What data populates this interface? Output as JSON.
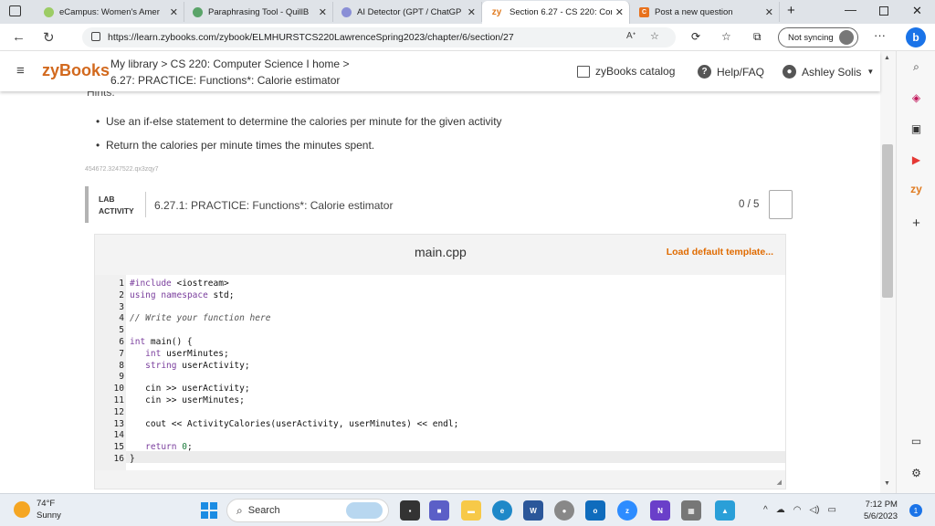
{
  "browser": {
    "tabs": [
      {
        "label": "eCampus: Women's Amer",
        "icon": "ecampus-icon",
        "color": "#9ccc65"
      },
      {
        "label": "Paraphrasing Tool - QuillB",
        "icon": "quillbot-icon",
        "color": "#5aa469"
      },
      {
        "label": "AI Detector (GPT / ChatGP",
        "icon": "ai-detector-icon",
        "color": "#8a8fd6"
      },
      {
        "label": "Section 6.27 - CS 220: Com",
        "icon": "zybooks-icon",
        "color": "#e07b20",
        "fav_text": "zy"
      },
      {
        "label": "Post a new question",
        "icon": "chegg-icon",
        "color": "#e8711c",
        "fav_text": "C"
      }
    ],
    "url": "https://learn.zybooks.com/zybook/ELMHURSTCS220LawrenceSpring2023/chapter/6/section/27",
    "sync_label": "Not syncing"
  },
  "header": {
    "logo": "zyBooks",
    "breadcrumb_line1": "My library > CS 220: Computer Science I home >",
    "breadcrumb_line2": "6.27: PRACTICE: Functions*: Calorie estimator",
    "catalog": "zyBooks catalog",
    "help": "Help/FAQ",
    "user": "Ashley Solis"
  },
  "content": {
    "hints_heading": "Hints:",
    "bullets": [
      "Use an if-else statement to determine the calories per minute for the given activity",
      "Return the calories per minute times the minutes spent."
    ],
    "hash_id": "454672.3247522.qx3zqy7",
    "lab": {
      "tag_line1": "LAB",
      "tag_line2": "ACTIVITY",
      "title": "6.27.1: PRACTICE: Functions*: Calorie estimator",
      "score": "0 / 5"
    },
    "editor": {
      "filename": "main.cpp",
      "load_template": "Load default template...",
      "lines": [
        "#include <iostream>",
        "using namespace std;",
        "",
        "// Write your function here",
        "",
        "int main() {",
        "   int userMinutes;",
        "   string userActivity;",
        "",
        "   cin >> userActivity;",
        "   cin >> userMinutes;",
        "",
        "   cout << ActivityCalories(userActivity, userMinutes) << endl;",
        "",
        "   return 0;",
        "}"
      ]
    }
  },
  "taskbar": {
    "temp": "74°F",
    "condition": "Sunny",
    "search": "Search",
    "time": "7:12 PM",
    "date": "5/6/2023",
    "notification_count": "1"
  },
  "colors": {
    "brand": "#d2691e",
    "load_template": "#e06b00",
    "tab_bar": "#dfe3e8"
  }
}
